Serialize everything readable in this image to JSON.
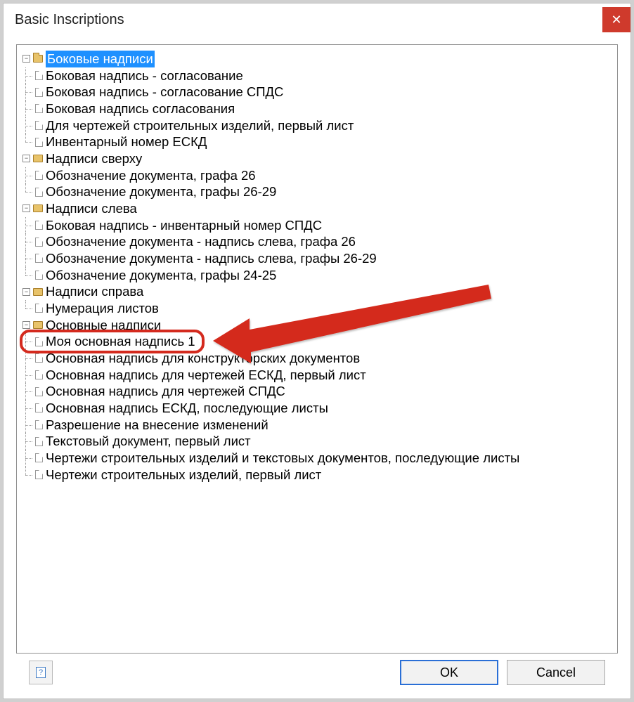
{
  "dialog": {
    "title": "Basic Inscriptions",
    "close_glyph": "✕"
  },
  "buttons": {
    "ok": "OK",
    "cancel": "Cancel"
  },
  "tree": {
    "root": {
      "label": "Боковые надписи",
      "children": [
        "Боковая надпись - согласование",
        "Боковая надпись - согласование СПДС",
        "Боковая надпись согласования",
        "Для чертежей строительных изделий, первый лист",
        "Инвентарный номер ЕСКД"
      ]
    },
    "g2": {
      "label": "Надписи сверху",
      "children": [
        "Обозначение документа, графа 26",
        "Обозначение документа, графы 26-29"
      ]
    },
    "g3": {
      "label": "Надписи слева",
      "children": [
        "Боковая надпись - инвентарный номер СПДС",
        "Обозначение документа - надпись слева, графа 26",
        "Обозначение документа - надпись слева, графы 26-29",
        "Обозначение документа, графы 24-25"
      ]
    },
    "g4": {
      "label": "Надписи справа",
      "children": [
        "Нумерация листов"
      ]
    },
    "g5": {
      "label": "Основные надписи",
      "children": [
        "Моя основная надпись 1",
        "Основная надпись для конструкторских документов",
        "Основная надпись для чертежей ЕСКД, первый лист",
        "Основная надпись для чертежей СПДС",
        "Основная надпись ЕСКД, последующие листы",
        "Разрешение на внесение изменений",
        "Текстовый документ, первый лист",
        "Чертежи строительных изделий и текстовых документов, последующие листы",
        "Чертежи строительных изделий, первый лист"
      ]
    }
  },
  "annotation": {
    "highlighted_item": "Моя основная надпись 1",
    "color": "#d42a1e"
  }
}
